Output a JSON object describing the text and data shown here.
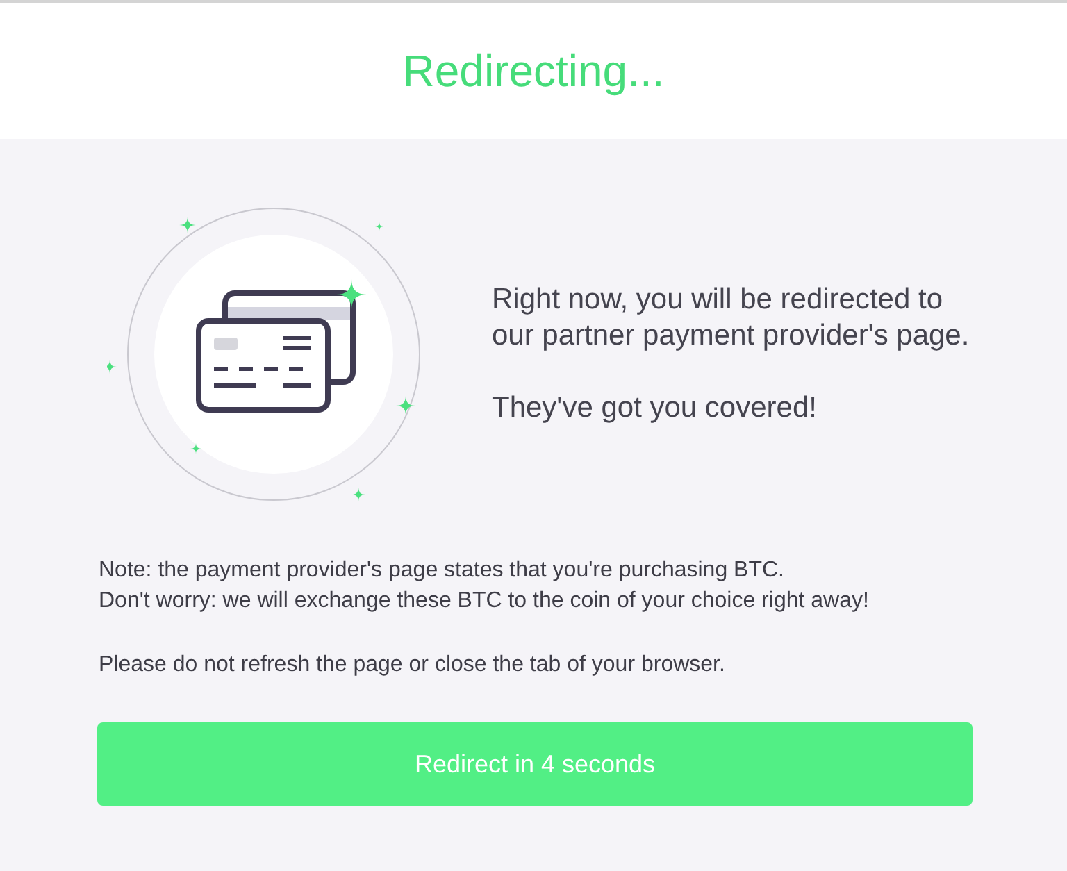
{
  "header": {
    "title": "Redirecting..."
  },
  "intro": [
    "Right now, you will be redirected to our partner payment provider's page.",
    "They've got you covered!"
  ],
  "notes": [
    "Note: the payment provider's page states that you're purchasing BTC.\nDon't worry: we will exchange these BTC to the coin of your choice right away!",
    "Please do not refresh the page or close the tab of your browser."
  ],
  "button": {
    "label": "Redirect in 4 seconds"
  }
}
